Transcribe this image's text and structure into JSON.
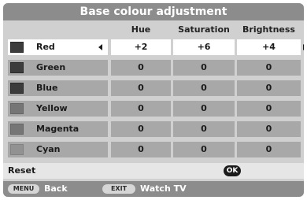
{
  "menu": {
    "title": "Base colour adjustment",
    "columns": [
      "Hue",
      "Saturation",
      "Brightness"
    ],
    "rows": [
      {
        "label": "Red",
        "hue": "+2",
        "saturation": "+6",
        "brightness": "+4",
        "selected": true
      },
      {
        "label": "Green",
        "hue": "0",
        "saturation": "0",
        "brightness": "0"
      },
      {
        "label": "Blue",
        "hue": "0",
        "saturation": "0",
        "brightness": "0"
      },
      {
        "label": "Yellow",
        "hue": "0",
        "saturation": "0",
        "brightness": "0"
      },
      {
        "label": "Magenta",
        "hue": "0",
        "saturation": "0",
        "brightness": "0"
      },
      {
        "label": "Cyan",
        "hue": "0",
        "saturation": "0",
        "brightness": "0"
      }
    ],
    "reset": {
      "label": "Reset",
      "button": "OK"
    }
  },
  "footer": {
    "menu_key": "MENU",
    "back_label": "Back",
    "exit_key": "EXIT",
    "watch_label": "Watch TV"
  },
  "colors": {
    "title_bar": "#8c8c8c",
    "panel": "#d0d0d0",
    "cell": "#a8a8a8",
    "selected_cell": "#ffffff"
  },
  "icons": {
    "left": "arrow-left-icon",
    "right": "arrow-right-icon",
    "ok": "ok-button-icon"
  }
}
